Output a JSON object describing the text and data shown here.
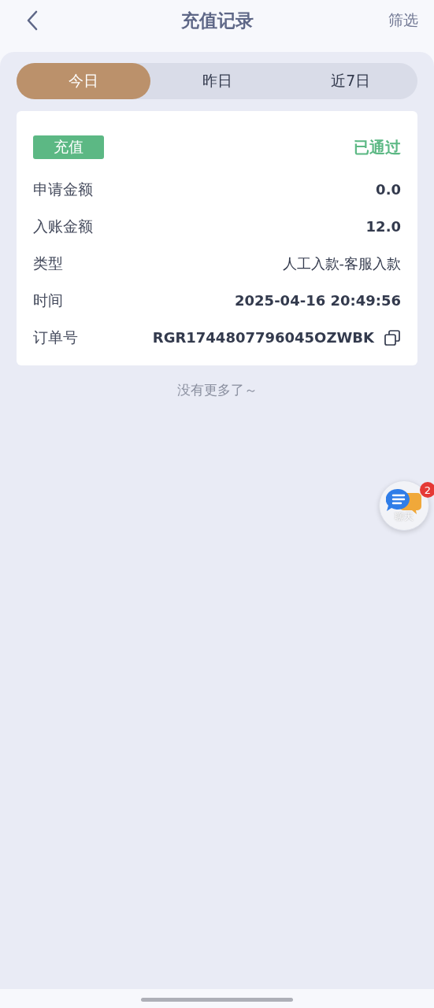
{
  "header": {
    "title": "充值记录",
    "action": "筛选"
  },
  "tabs": [
    {
      "label": "今日",
      "selected": true
    },
    {
      "label": "昨日",
      "selected": false
    },
    {
      "label": "近7日",
      "selected": false
    }
  ],
  "record": {
    "tag": "充值",
    "status": "已通过",
    "fields": [
      {
        "label": "申请金额",
        "value": "0.0",
        "kind": "number"
      },
      {
        "label": "入账金额",
        "value": "12.0",
        "kind": "number"
      },
      {
        "label": "类型",
        "value": "人工入款-客服入款",
        "kind": "text"
      },
      {
        "label": "时间",
        "value": "2025-04-16 20:49:56",
        "kind": "number"
      },
      {
        "label": "订单号",
        "value": "RGR1744807796045OZWBK",
        "kind": "copyable"
      }
    ]
  },
  "end_note": "没有更多了～",
  "chat": {
    "label": "聊天",
    "badge": "2"
  }
}
